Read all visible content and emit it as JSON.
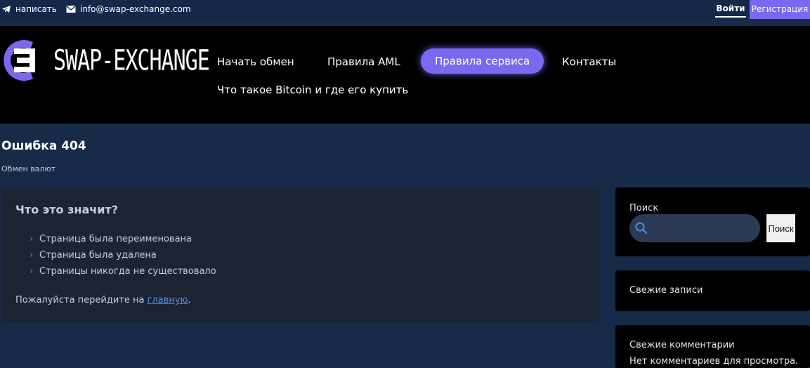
{
  "topbar": {
    "telegram_label": "написать",
    "email": "info@swap-exchange.com",
    "login": "Войти",
    "register": "Регистрация"
  },
  "header": {
    "logo_text": "SWAP-EXCHANGE",
    "nav": [
      {
        "label": "Начать обмен"
      },
      {
        "label": "Правила AML"
      },
      {
        "label": "Правила сервиса"
      },
      {
        "label": "Контакты"
      },
      {
        "label": "Что такое Bitcoin и где его купить"
      }
    ]
  },
  "page": {
    "title": "Ошибка 404",
    "breadcrumb": "Обмен валют"
  },
  "main": {
    "heading": "Что это значит?",
    "reasons": [
      "Страница была переименована",
      "Страница была удалена",
      "Страницы никогда не существовало"
    ],
    "hint_prefix": "Пожалуйста перейдите на ",
    "hint_link": "главную",
    "hint_suffix": "."
  },
  "sidebar": {
    "search_label": "Поиск",
    "search_button": "Поиск",
    "search_value": "",
    "recent_posts": "Свежие записи",
    "recent_comments": "Свежие комментарии",
    "no_comments": "Нет комментариев для просмотра."
  },
  "colors": {
    "accent": "#7b68f0",
    "page_bg": "#172a48",
    "link": "#4a8de8"
  }
}
